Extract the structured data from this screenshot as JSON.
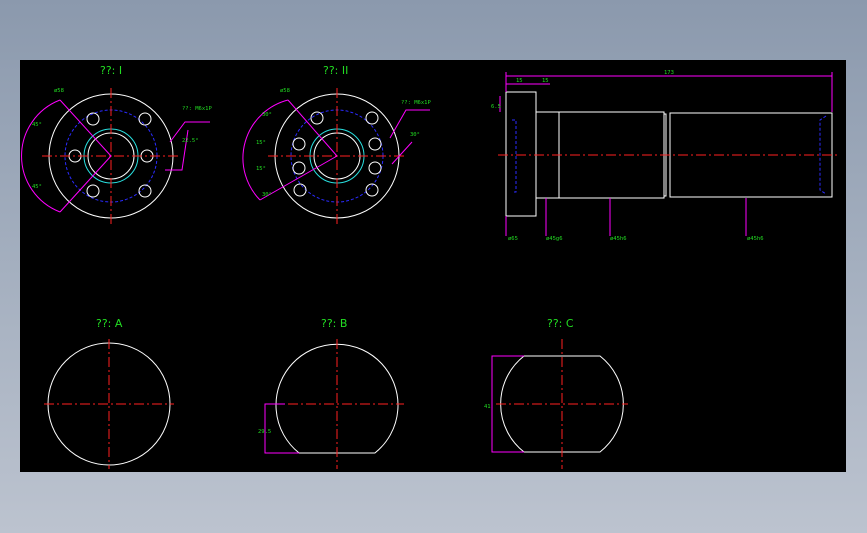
{
  "views": {
    "view_1": {
      "title": "??: I"
    },
    "view_2": {
      "title": "??: II"
    },
    "view_a": {
      "title": "??: A"
    },
    "view_b": {
      "title": "??: B"
    },
    "view_c": {
      "title": "??: C"
    }
  },
  "dimensions": {
    "v1": {
      "d1": "ø58",
      "thread": "??: M6x1P",
      "ang1": "45°",
      "ang2": "45°",
      "ang3": "22.5°"
    },
    "v2": {
      "d1": "ø58",
      "thread": "??: M6x1P",
      "a1": "30°",
      "a2": "15°",
      "a3": "15°",
      "a4": "30°",
      "a5": "30°"
    },
    "side": {
      "len_total": "173",
      "len_a": "15",
      "len_b": "15",
      "h": "6.5",
      "dia1": "ø65",
      "dia2": "ø45g6",
      "dia3": "ø45h6",
      "dia4": "ø45h6"
    },
    "vb": {
      "h": "29.5"
    },
    "vc": {
      "h": "41"
    }
  },
  "colors": {
    "background": "#000000",
    "outline": "#ffffff",
    "centerline": "#ff2020",
    "hidden": "#2b2bff",
    "dimension": "#ff00ff",
    "text": "#22dd22"
  }
}
